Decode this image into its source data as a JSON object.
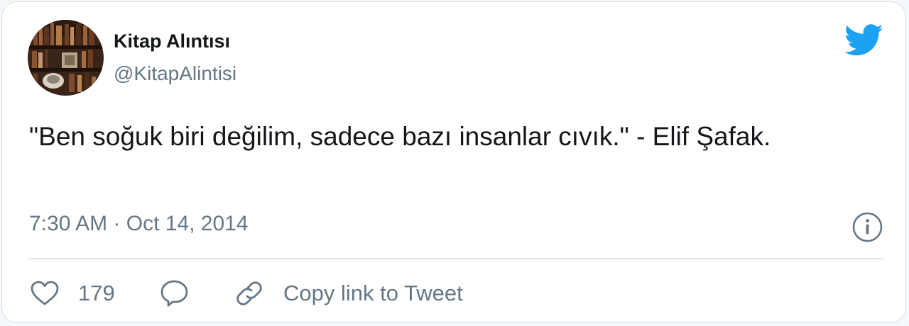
{
  "tweet": {
    "author_name": "Kitap Alıntısı",
    "author_handle": "@KitapAlintisi",
    "text": "\"Ben soğuk biri değilim, sadece bazı insanlar cıvık.\" - Elif Şafak.",
    "time": "7:30 AM",
    "separator": "·",
    "date": "Oct 14, 2014"
  },
  "actions": {
    "like_count": "179",
    "copy_link_label": "Copy link to Tweet"
  },
  "icons": {
    "logo": "twitter-bird-icon",
    "info": "info-icon",
    "like": "heart-icon",
    "reply": "reply-bubble-icon",
    "copy": "link-icon"
  },
  "colors": {
    "brand_blue": "#1da1f2",
    "text_primary": "#14171a",
    "text_secondary": "#657786",
    "divider": "#e1e8ed",
    "background": "#ffffff"
  }
}
